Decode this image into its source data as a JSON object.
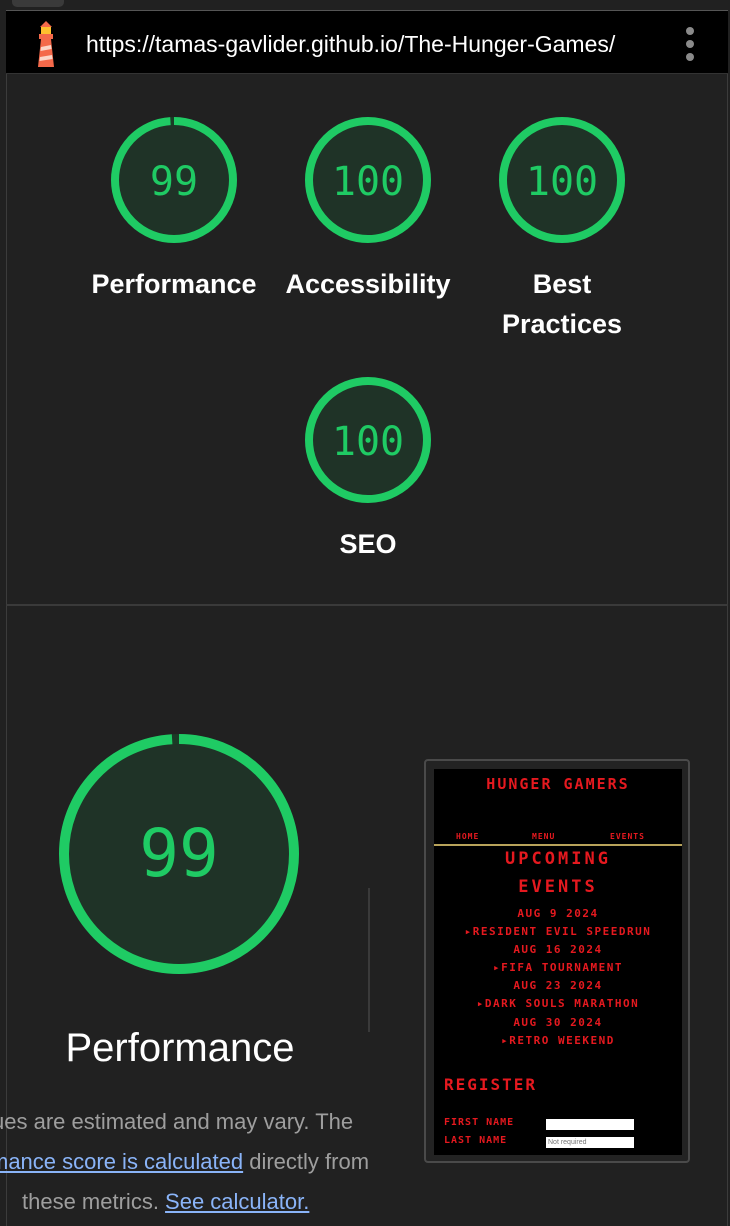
{
  "topbar": {
    "url": "https://tamas-gavlider.github.io/The-Hunger-Games/",
    "logo_icon": "lighthouse-icon",
    "menu_icon": "kebab-menu-icon"
  },
  "scores": [
    {
      "value": "99",
      "label": "Performance",
      "fraction": 0.99
    },
    {
      "value": "100",
      "label": "Accessibility",
      "fraction": 1.0
    },
    {
      "value": "100",
      "label_line1": "Best",
      "label_line2": "Practices",
      "fraction": 1.0
    },
    {
      "value": "100",
      "label": "SEO",
      "fraction": 1.0
    }
  ],
  "performance": {
    "score": "99",
    "fraction": 0.99,
    "title": "Performance",
    "desc_line1": "ues are estimated and may vary. The",
    "desc_link1": "mance score is calculated",
    "desc_line2_rest": " directly from",
    "desc_line3": "these metrics. ",
    "desc_link2": "See calculator."
  },
  "screenshot": {
    "site_title": "HUNGER GAMERS",
    "nav": [
      "HOME",
      "MENU",
      "EVENTS"
    ],
    "heading_line1": "UPCOMING",
    "heading_line2": "EVENTS",
    "events": [
      {
        "date": "AUG 9 2024",
        "name": "▸RESIDENT EVIL SPEEDRUN"
      },
      {
        "date": "AUG 16 2024",
        "name": "▸FIFA TOURNAMENT"
      },
      {
        "date": "AUG 23 2024",
        "name": "▸DARK SOULS MARATHON"
      },
      {
        "date": "AUG 30 2024",
        "name": "▸RETRO WEEKEND"
      }
    ],
    "register": "REGISTER",
    "first_name": "FIRST NAME",
    "last_name": "LAST NAME",
    "last_name_placeholder": "Not required"
  },
  "colors": {
    "good": "#1fcb64",
    "gauge_fill": "#1f3327",
    "link": "#8ab4f8",
    "site_red": "#e5191f"
  }
}
